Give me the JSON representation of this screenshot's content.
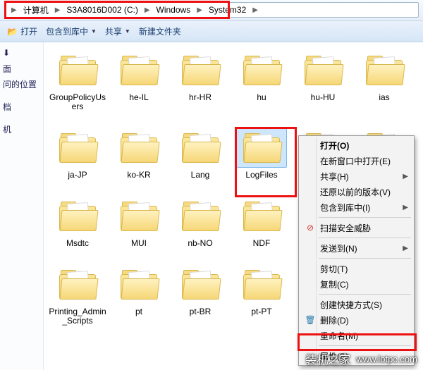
{
  "breadcrumb": [
    "计算机",
    "S3A8016D002 (C:)",
    "Windows",
    "System32"
  ],
  "cmdbar": {
    "open": "打开",
    "include": "包含到库中",
    "share": "共享",
    "new_folder": "新建文件夹"
  },
  "sidebar": {
    "recent": "问的位置"
  },
  "folders": [
    {
      "n": "GroupPolicyUsers"
    },
    {
      "n": "he-IL"
    },
    {
      "n": "hr-HR"
    },
    {
      "n": "hu"
    },
    {
      "n": "hu-HU"
    },
    {
      "n": "ias"
    },
    {
      "n": "ja-JP"
    },
    {
      "n": "ko-KR"
    },
    {
      "n": "Lang"
    },
    {
      "n": "LogFiles",
      "sel": true
    },
    {
      "n": ""
    },
    {
      "n": ""
    },
    {
      "n": "Msdtc"
    },
    {
      "n": "MUI"
    },
    {
      "n": "nb-NO"
    },
    {
      "n": "NDF"
    },
    {
      "n": ""
    },
    {
      "n": ""
    },
    {
      "n": "Printing_Admin_Scripts"
    },
    {
      "n": "pt"
    },
    {
      "n": "pt-BR"
    },
    {
      "n": "pt-PT"
    },
    {
      "n": ""
    },
    {
      "n": ""
    }
  ],
  "menu": {
    "open": "打开(O)",
    "open_new": "在新窗口中打开(E)",
    "share": "共享(H)",
    "restore": "还原以前的版本(V)",
    "include": "包含到库中(I)",
    "scan": "扫描安全威胁",
    "send_to": "发送到(N)",
    "cut": "剪切(T)",
    "copy": "复制(C)",
    "shortcut": "创建快捷方式(S)",
    "delete": "删除(D)",
    "rename": "重命名(M)",
    "properties": "属性(R)"
  },
  "watermark": {
    "site": "装机之家",
    "url": "www.lotpc.com"
  }
}
